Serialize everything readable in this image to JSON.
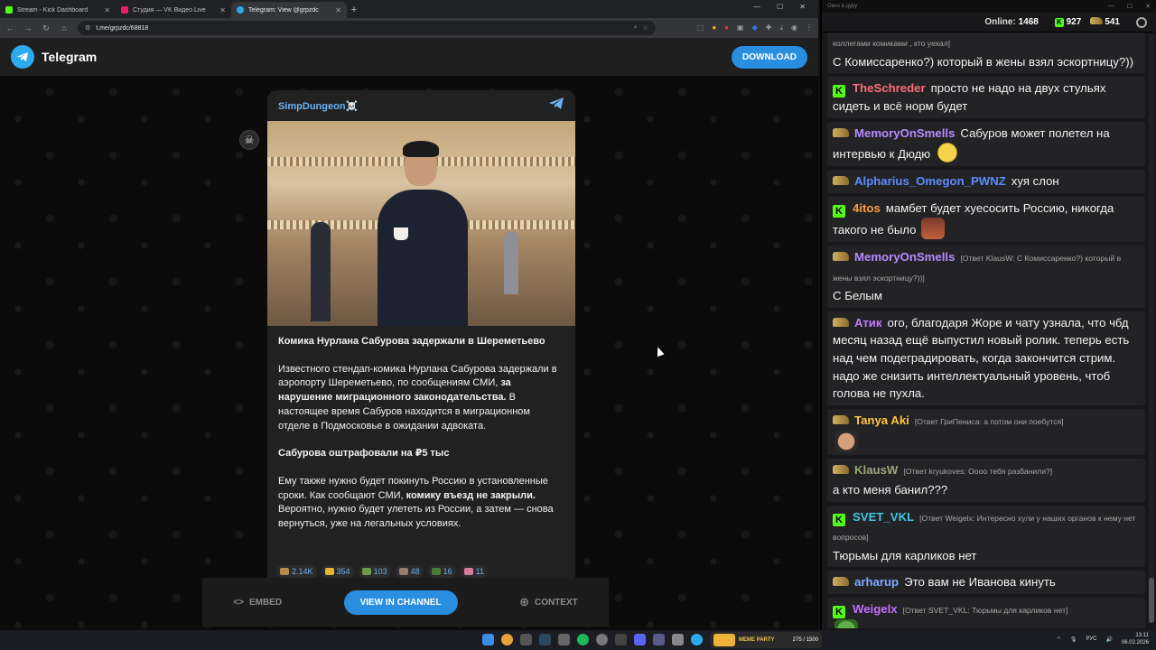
{
  "browser": {
    "tabs": [
      {
        "title": "Stream - Kick Dashboard",
        "favicon_color": "#53fc18"
      },
      {
        "title": "Студия — VK Видео Live",
        "favicon_color": "#e91e63"
      },
      {
        "title": "Telegram: View @grpzdc",
        "favicon_color": "#2aabee"
      }
    ],
    "url": "t.me/grpzdc/68818"
  },
  "telegram": {
    "brand": "Telegram",
    "download_label": "DOWNLOAD",
    "channel_name": "SimpDungeon☠️",
    "post_title": "Комика Нурлана Сабурова задержали в Шереметьево",
    "para1_start": "Известного стендап-комика Нурлана Сабурова задержали в аэропорту Шереметьево, по сообщениям СМИ,",
    "para1_bold": "за нарушение миграционного законодательства.",
    "para1_end": "В настоящее время Сабуров находится в миграционном отделе в Подмосковье в ожидании адвоката.",
    "subtitle": "Сабурова оштрафовали на ₽5 тыс",
    "para3_start": "Ему также нужно будет покинуть Россию в установленные сроки. Как сообщают СМИ,",
    "para3_bold": "комику въезд не закрыли.",
    "para3_end": "Вероятно, нужно будет улететь из России, а затем — снова вернуться, уже на легальных условиях.",
    "reactions": [
      "2.14K",
      "354",
      "103",
      "48",
      "16",
      "11"
    ],
    "actions": {
      "embed": "EMBED",
      "view": "VIEW IN CHANNEL",
      "context": "CONTEXT"
    }
  },
  "chat": {
    "window_title": "Окно в дуру",
    "online_label": "Online:",
    "online_count": "1468",
    "kick_count": "927",
    "vk_count": "541",
    "messages": [
      {
        "badge": "none",
        "user": "",
        "color": "",
        "reply": "",
        "text": "",
        "pre": "коллегами комиками , кто уехал]",
        "tail": "С Комиссаренко?) который в жены взял эскортницу?))"
      },
      {
        "badge": "kick",
        "user": "TheSchreder",
        "color": "#ff6b7d",
        "reply": "",
        "text": "просто не надо на двух стульях сидеть и всё норм будет"
      },
      {
        "badge": "vk",
        "user": "MemoryOnSmells",
        "color": "#b48cff",
        "reply": "",
        "text": "Сабуров может полетел на интервью к Дюдю"
      },
      {
        "badge": "vk",
        "user": "Alpharius_Omegon_PWNZ",
        "color": "#5b8cff",
        "reply": "",
        "text": "хуя слон"
      },
      {
        "badge": "kick",
        "user": "4itos",
        "color": "#ff9c3a",
        "reply": "",
        "text": "мамбет будет хуесосить Россию, никогда такого не было"
      },
      {
        "badge": "vk",
        "user": "MemoryOnSmells",
        "color": "#b48cff",
        "reply": "[Ответ KlausW: С Комиссаренко?) который в жены взял эскортницу?))]",
        "text": "С Белым"
      },
      {
        "badge": "vk",
        "user": "Атик",
        "color": "#c27cff",
        "reply": "",
        "text": "ого, благодаря Жоре и чату узнала, что чбд месяц назад ещё выпустил новый ролик. теперь есть над чем подеградировать, когда закончится стрим. надо же снизить интеллектуальный уровень, чтоб голова не пухла."
      },
      {
        "badge": "vk",
        "user": "Tanya Aki",
        "color": "#ffc53a",
        "reply": "[Ответ ГриПениса: а потом они поебутся]",
        "text": ""
      },
      {
        "badge": "vk",
        "user": "KlausW",
        "color": "#9aa67a",
        "reply": "[Ответ kryukoves: Оооо тебя разбанили?]",
        "text": "а кто меня банил???"
      },
      {
        "badge": "kick",
        "user": "SVET_VKL",
        "color": "#3ec6e0",
        "reply": "[Ответ Weigelx: Интересно хули у наших органов к нему нет вопросов]",
        "text": "Тюрьмы для карликов нет"
      },
      {
        "badge": "vk",
        "user": "arharup",
        "color": "#7fa8ff",
        "reply": "",
        "text": "Это вам не Иванова кинуть"
      },
      {
        "badge": "kick",
        "user": "Weigelx",
        "color": "#c56cff",
        "reply": "[Ответ SVET_VKL: Тюрьмы для карликов нет]",
        "text": ""
      }
    ]
  },
  "taskbar": {
    "widget_label": "MEME PARTY",
    "widget_progress": "275 / 1500",
    "lang": "РУС",
    "time": "13:11",
    "date": "06.02.2026"
  }
}
